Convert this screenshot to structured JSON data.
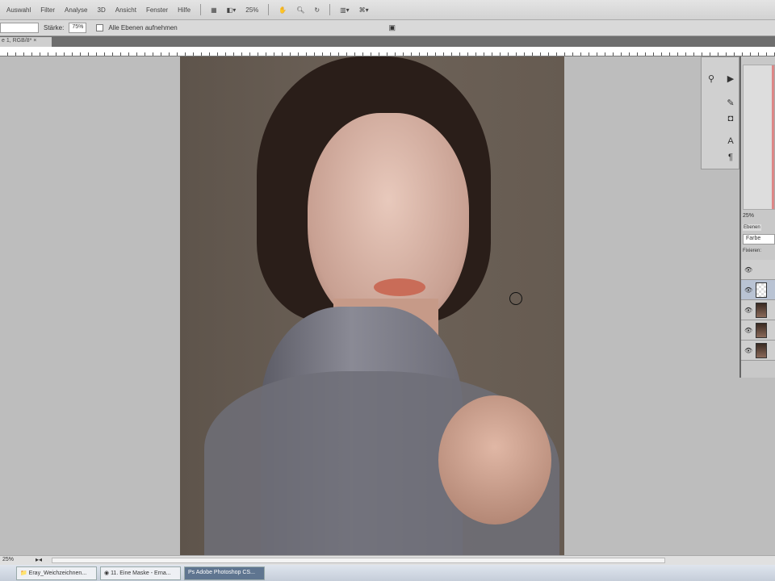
{
  "menu": [
    "Auswahl",
    "Filter",
    "Analyse",
    "3D",
    "Ansicht",
    "Fenster",
    "Hilfe"
  ],
  "toolbar": {
    "zoom": "25%"
  },
  "options": {
    "strength_label": "Stärke:",
    "strength_value": "75%",
    "sample_all_layers": "Alle Ebenen aufnehmen"
  },
  "document_tab": "e 1, RGB/8*",
  "panel": {
    "zoom": "25%",
    "layers_tab": "Ebenen",
    "blend_mode": "Farbe",
    "opacity_label": "Fixieren:"
  },
  "status": {
    "zoom": "25%"
  },
  "taskbar": [
    "Eray_Weichzeichnen...",
    "11. Eine Maske - Erna...",
    "Adobe Photoshop CS..."
  ]
}
